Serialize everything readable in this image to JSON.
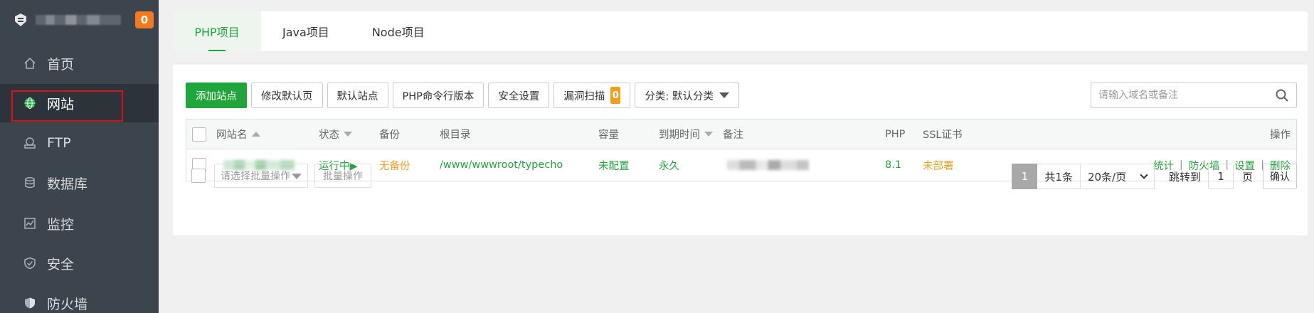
{
  "sidebar": {
    "notification_count": "0",
    "items": [
      {
        "label": "首页",
        "icon": "home-icon"
      },
      {
        "label": "网站",
        "icon": "globe-icon"
      },
      {
        "label": "FTP",
        "icon": "ftp-icon"
      },
      {
        "label": "数据库",
        "icon": "database-icon"
      },
      {
        "label": "监控",
        "icon": "monitor-icon"
      },
      {
        "label": "安全",
        "icon": "shield-check-icon"
      },
      {
        "label": "防火墙",
        "icon": "firewall-shield-icon"
      }
    ],
    "active_item": "网站"
  },
  "tabs": [
    "PHP项目",
    "Java项目",
    "Node项目"
  ],
  "toolbar": {
    "add_site": "添加站点",
    "edit_default_page": "修改默认页",
    "default_site": "默认站点",
    "php_cli_version": "PHP命令行版本",
    "security_settings": "安全设置",
    "vuln_scan": "漏洞扫描",
    "vuln_scan_count": "0",
    "category_label": "分类: 默认分类"
  },
  "search": {
    "placeholder": "请输入域名或备注",
    "value": ""
  },
  "table": {
    "headers": {
      "site_name": "网站名",
      "status": "状态",
      "backup": "备份",
      "root_dir": "根目录",
      "capacity": "容量",
      "expiry": "到期时间",
      "note": "备注",
      "php": "PHP",
      "ssl": "SSL证书",
      "actions": "操作"
    },
    "rows": [
      {
        "status": "运行中▶",
        "backup": "无备份",
        "root_dir": "/www/wwwroot/typecho",
        "capacity": "未配置",
        "expiry": "永久",
        "php": "8.1",
        "ssl": "未部署",
        "actions": [
          "统计",
          "防火墙",
          "设置",
          "删除"
        ]
      }
    ]
  },
  "footer": {
    "batch_placeholder": "请选择批量操作",
    "batch_button": "批量操作",
    "current_page": "1",
    "total": "共1条",
    "page_size": "20条/页",
    "jump_label": "跳转到",
    "jump_value": "1",
    "page_unit": "页",
    "confirm": "确认"
  },
  "colors": {
    "accent": "#20a53a",
    "warning": "#f0a020",
    "sidebar_bg": "#3c444d",
    "badge": "#f37b1d",
    "highlight_box": "#e01010"
  }
}
